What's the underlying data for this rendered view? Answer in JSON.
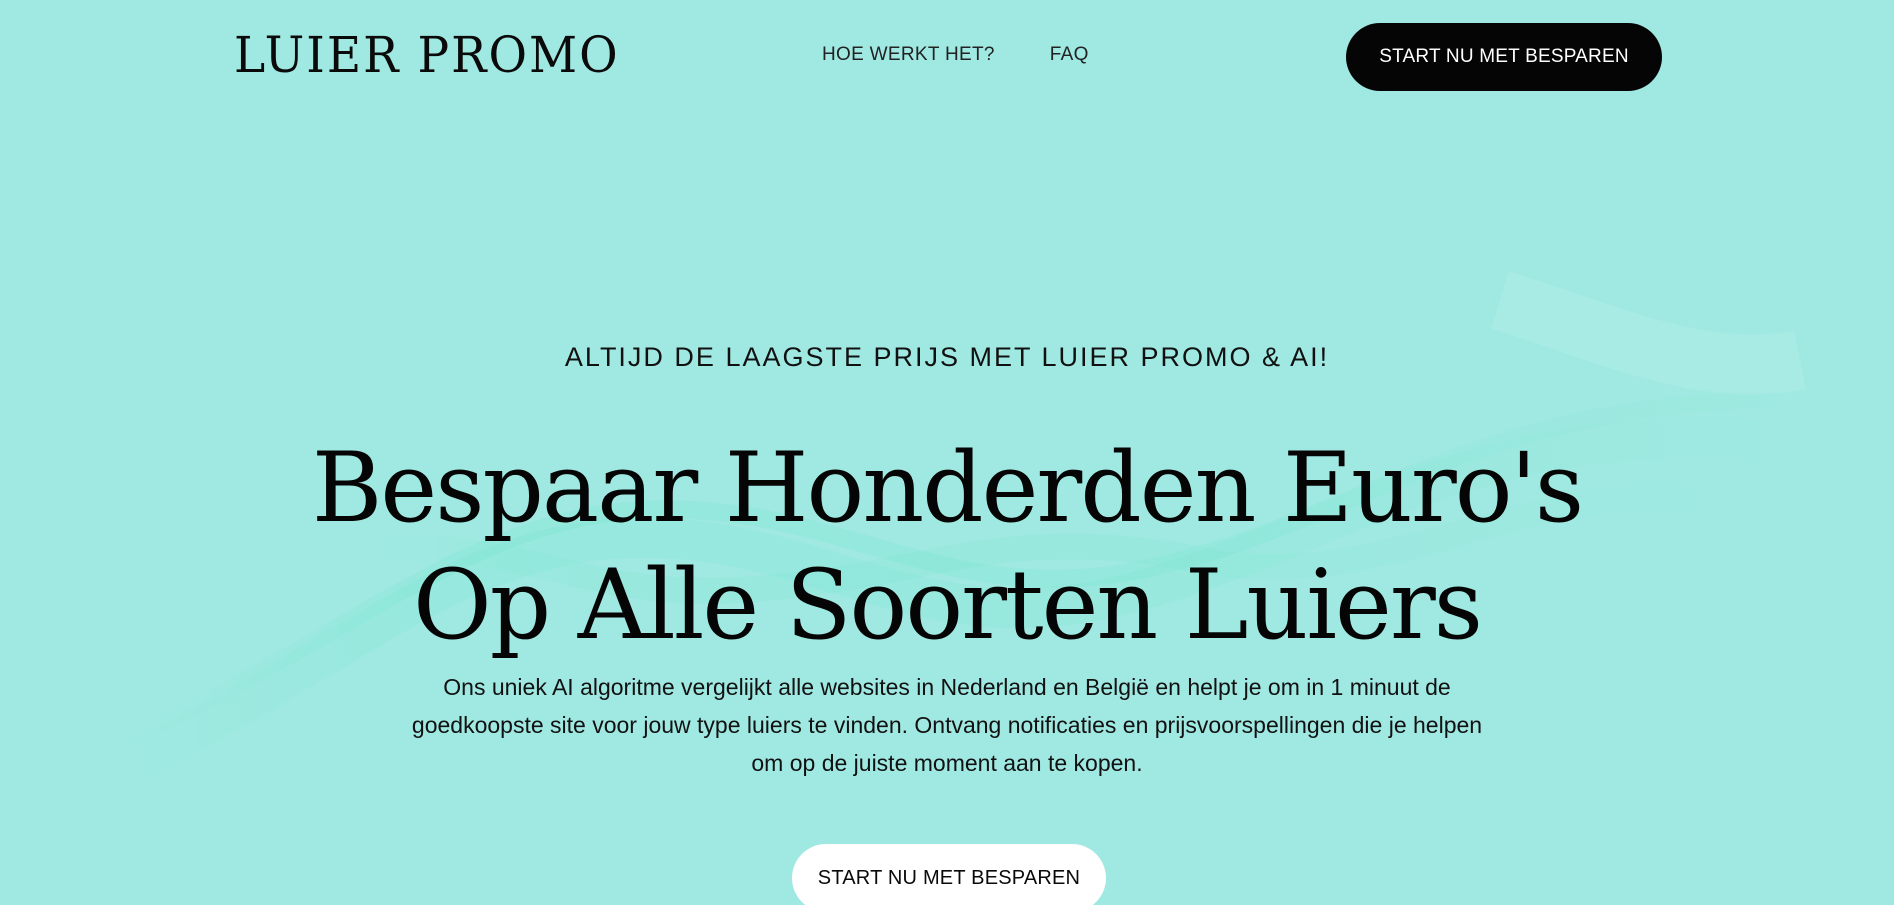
{
  "header": {
    "logo": "LUIER PROMO",
    "nav": [
      {
        "label": "HOE WERKT HET?"
      },
      {
        "label": "FAQ"
      }
    ],
    "cta_label": "START NU MET BESPAREN"
  },
  "hero": {
    "eyebrow": "ALTIJD DE LAAGSTE PRIJS MET LUIER PROMO & AI!",
    "headline_line1": "Bespaar Honderden Euro's",
    "headline_line2": "Op Alle Soorten Luiers",
    "subtext": "Ons uniek AI algoritme vergelijkt alle websites in Nederland en België en helpt je om in 1 minuut de goedkoopste site voor jouw type luiers te vinden. Ontvang notificaties en prijsvoorspellingen die je helpen om op de juiste moment aan te kopen.",
    "cta_label": "START NU MET BESPAREN"
  },
  "colors": {
    "background": "#a0e9e2",
    "wave": "#6fe3cb",
    "header_button_bg": "#050505",
    "hero_button_bg": "#ffffff"
  }
}
